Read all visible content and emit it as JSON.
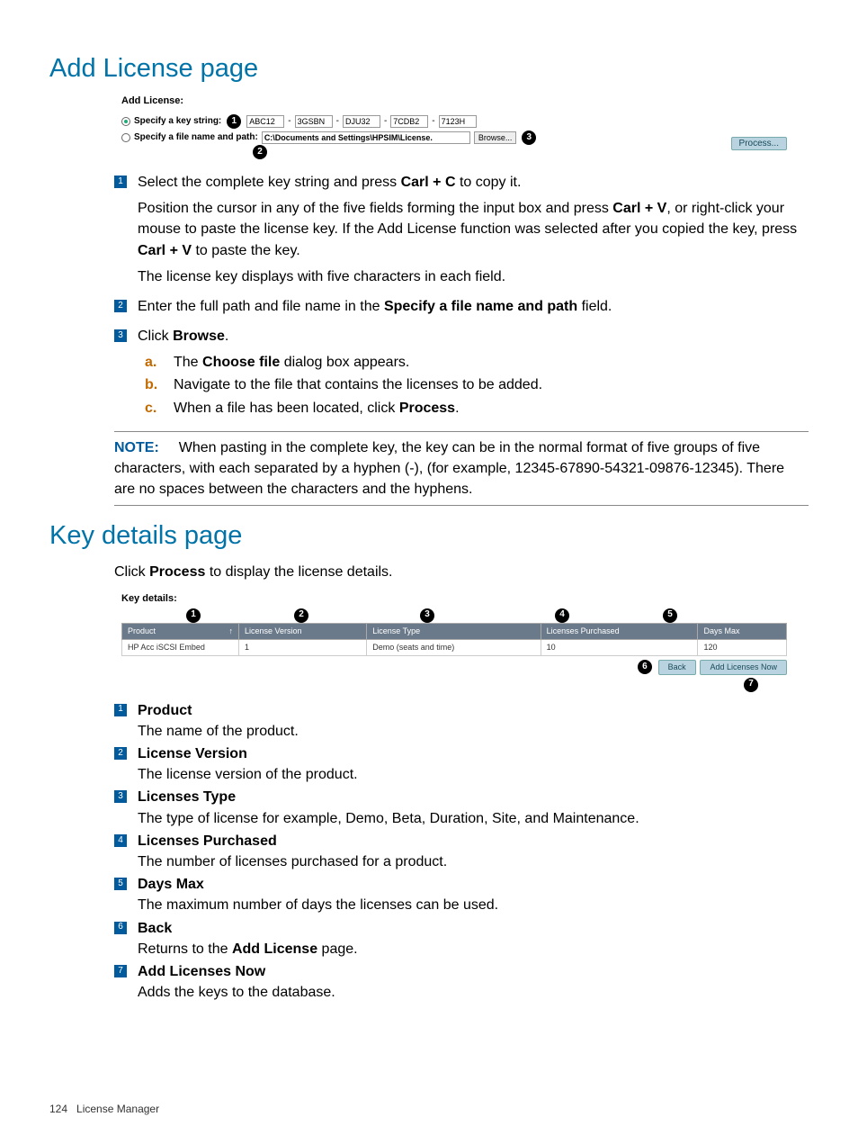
{
  "page": {
    "h1_add_license": "Add License page",
    "h1_key_details": "Key details page",
    "footer_page": "124",
    "footer_section": "License Manager"
  },
  "screenshot1": {
    "title": "Add License:",
    "opt1_label": "Specify a key string:",
    "opt2_label": "Specify a file name and path:",
    "key1": "ABC12",
    "key2": "3GSBN",
    "key3": "DJU32",
    "key4": "7CDB2",
    "key5": "7123H",
    "path_value": "C:\\Documents and Settings\\HPSIM\\License.",
    "browse": "Browse...",
    "process": "Process..."
  },
  "callouts": {
    "c1": "1",
    "c2": "2",
    "c3": "3",
    "c4": "4",
    "c5": "5",
    "c6": "6",
    "c7": "7"
  },
  "steps1": {
    "s1a": "Select the complete key string and press ",
    "s1b": "Carl + C",
    "s1c": " to copy it.",
    "s1p2a": "Position the cursor in any of the five fields forming the input box and press ",
    "s1p2b": "Carl + V",
    "s1p2c": ", or right-click your mouse to paste the license key. If the Add License function was selected after you copied the key, press ",
    "s1p2d": "Carl + V",
    "s1p2e": " to paste the key.",
    "s1p3": "The license key displays with five characters in each field.",
    "s2a": "Enter the full path and file name in the ",
    "s2b": "Specify a file name and path",
    "s2c": " field.",
    "s3a": "Click ",
    "s3b": "Browse",
    "s3c": ".",
    "sub_a": "a.",
    "sub_a_t1": "The ",
    "sub_a_t2": "Choose file",
    "sub_a_t3": " dialog box appears.",
    "sub_b": "b.",
    "sub_b_t": "Navigate to the file that contains the licenses to be added.",
    "sub_c": "c.",
    "sub_c_t1": "When a file has been located, click ",
    "sub_c_t2": "Process",
    "sub_c_t3": "."
  },
  "note": {
    "label": "NOTE:",
    "body": "When pasting in the complete key, the key can be in the normal format of five groups of five characters, with each separated by a hyphen (-), (for example, 12345-67890-54321-09876-12345). There are no spaces between the characters and the hyphens."
  },
  "intro2a": "Click  ",
  "intro2b": "Process",
  "intro2c": " to display the license details.",
  "screenshot2": {
    "title": "Key details:",
    "cols": {
      "c1": "Product",
      "c2": "License Version",
      "c3": "License Type",
      "c4": "Licenses Purchased",
      "c5": "Days Max"
    },
    "row": {
      "c1": "HP Acc iSCSI Embed",
      "c2": "1",
      "c3": "Demo (seats and time)",
      "c4": "10",
      "c5": "120"
    },
    "back": "Back",
    "addnow": "Add Licenses Now",
    "sort": "↑"
  },
  "desc": {
    "d1t": "Product",
    "d1b": "The name of the product.",
    "d2t": "License Version",
    "d2b": "The license version of the product.",
    "d3t": "Licenses Type",
    "d3b": "The type of license for example, Demo, Beta, Duration, Site, and Maintenance.",
    "d4t": "Licenses Purchased",
    "d4b": "The number of licenses purchased for a product.",
    "d5t": "Days Max",
    "d5b": "The maximum number of days the licenses can be used.",
    "d6t": "Back",
    "d6b1": "Returns to the ",
    "d6b2": "Add License",
    "d6b3": "  page.",
    "d7t": "Add Licenses Now",
    "d7b": "Adds the keys to the database."
  }
}
